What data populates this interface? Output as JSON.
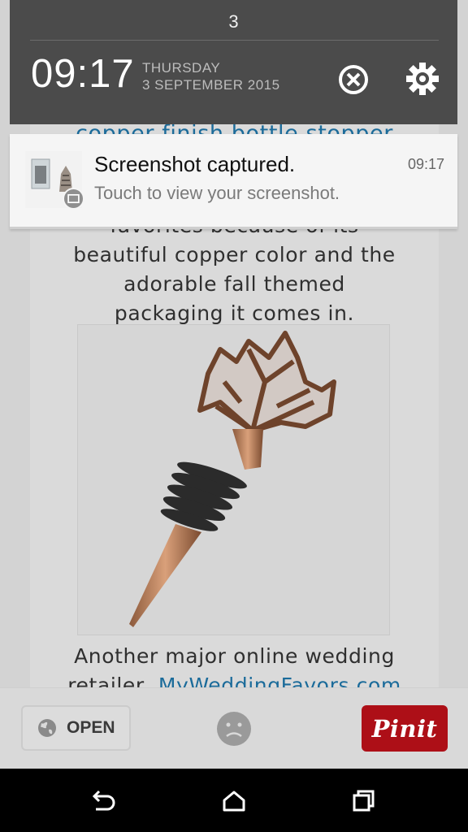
{
  "status": {
    "notification_count": "3",
    "time": "09:17",
    "day": "THURSDAY",
    "date": "3 SEPTEMBER 2015"
  },
  "notification": {
    "title": "Screenshot captured.",
    "body": "Touch to view your screenshot.",
    "time": "09:17",
    "icon": "screenshot-thumbnail"
  },
  "article": {
    "partial_heading": "copper finish bottle stopper",
    "para1_cut": "favorites because of its",
    "para1_lines": [
      "beautiful copper color and the",
      "adorable fall themed",
      "packaging it comes in."
    ],
    "para2_line1": "Another major online wedding",
    "para2_line2_text": "retailer, ",
    "para2_link": "MyWeddingFavors.com"
  },
  "actions": {
    "open_label": "OPEN",
    "pin_label": "Pinit"
  },
  "colors": {
    "shade_bg": "#4b4b4b",
    "pin_red": "#ad0f17",
    "link_blue": "#1b6b9a"
  },
  "icons": [
    "dismiss-all-icon",
    "settings-gear-icon",
    "globe-icon",
    "sad-face-icon",
    "back-icon",
    "home-icon",
    "recents-icon"
  ]
}
